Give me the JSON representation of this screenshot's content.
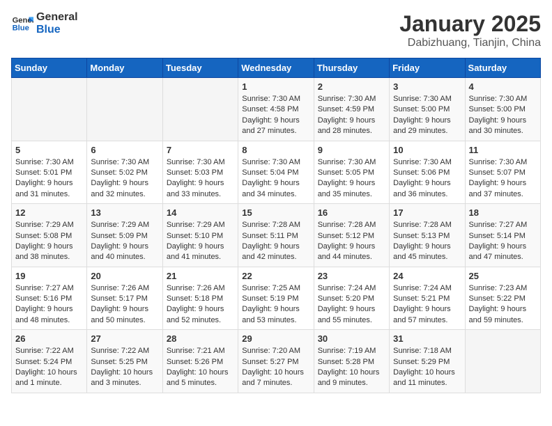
{
  "header": {
    "logo_general": "General",
    "logo_blue": "Blue",
    "title": "January 2025",
    "subtitle": "Dabizhuang, Tianjin, China"
  },
  "weekdays": [
    "Sunday",
    "Monday",
    "Tuesday",
    "Wednesday",
    "Thursday",
    "Friday",
    "Saturday"
  ],
  "weeks": [
    [
      {
        "day": "",
        "info": ""
      },
      {
        "day": "",
        "info": ""
      },
      {
        "day": "",
        "info": ""
      },
      {
        "day": "1",
        "info": "Sunrise: 7:30 AM\nSunset: 4:58 PM\nDaylight: 9 hours and 27 minutes."
      },
      {
        "day": "2",
        "info": "Sunrise: 7:30 AM\nSunset: 4:59 PM\nDaylight: 9 hours and 28 minutes."
      },
      {
        "day": "3",
        "info": "Sunrise: 7:30 AM\nSunset: 5:00 PM\nDaylight: 9 hours and 29 minutes."
      },
      {
        "day": "4",
        "info": "Sunrise: 7:30 AM\nSunset: 5:00 PM\nDaylight: 9 hours and 30 minutes."
      }
    ],
    [
      {
        "day": "5",
        "info": "Sunrise: 7:30 AM\nSunset: 5:01 PM\nDaylight: 9 hours and 31 minutes."
      },
      {
        "day": "6",
        "info": "Sunrise: 7:30 AM\nSunset: 5:02 PM\nDaylight: 9 hours and 32 minutes."
      },
      {
        "day": "7",
        "info": "Sunrise: 7:30 AM\nSunset: 5:03 PM\nDaylight: 9 hours and 33 minutes."
      },
      {
        "day": "8",
        "info": "Sunrise: 7:30 AM\nSunset: 5:04 PM\nDaylight: 9 hours and 34 minutes."
      },
      {
        "day": "9",
        "info": "Sunrise: 7:30 AM\nSunset: 5:05 PM\nDaylight: 9 hours and 35 minutes."
      },
      {
        "day": "10",
        "info": "Sunrise: 7:30 AM\nSunset: 5:06 PM\nDaylight: 9 hours and 36 minutes."
      },
      {
        "day": "11",
        "info": "Sunrise: 7:30 AM\nSunset: 5:07 PM\nDaylight: 9 hours and 37 minutes."
      }
    ],
    [
      {
        "day": "12",
        "info": "Sunrise: 7:29 AM\nSunset: 5:08 PM\nDaylight: 9 hours and 38 minutes."
      },
      {
        "day": "13",
        "info": "Sunrise: 7:29 AM\nSunset: 5:09 PM\nDaylight: 9 hours and 40 minutes."
      },
      {
        "day": "14",
        "info": "Sunrise: 7:29 AM\nSunset: 5:10 PM\nDaylight: 9 hours and 41 minutes."
      },
      {
        "day": "15",
        "info": "Sunrise: 7:28 AM\nSunset: 5:11 PM\nDaylight: 9 hours and 42 minutes."
      },
      {
        "day": "16",
        "info": "Sunrise: 7:28 AM\nSunset: 5:12 PM\nDaylight: 9 hours and 44 minutes."
      },
      {
        "day": "17",
        "info": "Sunrise: 7:28 AM\nSunset: 5:13 PM\nDaylight: 9 hours and 45 minutes."
      },
      {
        "day": "18",
        "info": "Sunrise: 7:27 AM\nSunset: 5:14 PM\nDaylight: 9 hours and 47 minutes."
      }
    ],
    [
      {
        "day": "19",
        "info": "Sunrise: 7:27 AM\nSunset: 5:16 PM\nDaylight: 9 hours and 48 minutes."
      },
      {
        "day": "20",
        "info": "Sunrise: 7:26 AM\nSunset: 5:17 PM\nDaylight: 9 hours and 50 minutes."
      },
      {
        "day": "21",
        "info": "Sunrise: 7:26 AM\nSunset: 5:18 PM\nDaylight: 9 hours and 52 minutes."
      },
      {
        "day": "22",
        "info": "Sunrise: 7:25 AM\nSunset: 5:19 PM\nDaylight: 9 hours and 53 minutes."
      },
      {
        "day": "23",
        "info": "Sunrise: 7:24 AM\nSunset: 5:20 PM\nDaylight: 9 hours and 55 minutes."
      },
      {
        "day": "24",
        "info": "Sunrise: 7:24 AM\nSunset: 5:21 PM\nDaylight: 9 hours and 57 minutes."
      },
      {
        "day": "25",
        "info": "Sunrise: 7:23 AM\nSunset: 5:22 PM\nDaylight: 9 hours and 59 minutes."
      }
    ],
    [
      {
        "day": "26",
        "info": "Sunrise: 7:22 AM\nSunset: 5:24 PM\nDaylight: 10 hours and 1 minute."
      },
      {
        "day": "27",
        "info": "Sunrise: 7:22 AM\nSunset: 5:25 PM\nDaylight: 10 hours and 3 minutes."
      },
      {
        "day": "28",
        "info": "Sunrise: 7:21 AM\nSunset: 5:26 PM\nDaylight: 10 hours and 5 minutes."
      },
      {
        "day": "29",
        "info": "Sunrise: 7:20 AM\nSunset: 5:27 PM\nDaylight: 10 hours and 7 minutes."
      },
      {
        "day": "30",
        "info": "Sunrise: 7:19 AM\nSunset: 5:28 PM\nDaylight: 10 hours and 9 minutes."
      },
      {
        "day": "31",
        "info": "Sunrise: 7:18 AM\nSunset: 5:29 PM\nDaylight: 10 hours and 11 minutes."
      },
      {
        "day": "",
        "info": ""
      }
    ]
  ]
}
